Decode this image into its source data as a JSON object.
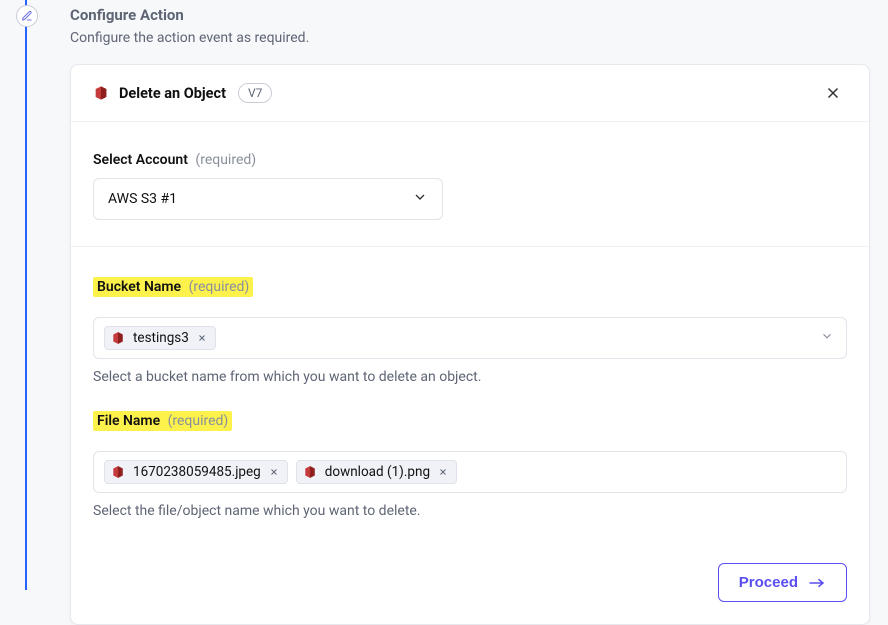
{
  "header": {
    "title": "Configure Action",
    "subtitle": "Configure the action event as required."
  },
  "card": {
    "title": "Delete an Object",
    "version": "V7"
  },
  "account": {
    "label": "Select Account",
    "required_text": "(required)",
    "value": "AWS S3 #1"
  },
  "bucket": {
    "label": "Bucket Name",
    "required_text": "(required)",
    "chips": [
      "testings3"
    ],
    "helper": "Select a bucket name from which you want to delete an object."
  },
  "file": {
    "label": "File Name",
    "required_text": "(required)",
    "chips": [
      "1670238059485.jpeg",
      "download (1).png"
    ],
    "helper": "Select the file/object name which you want to delete."
  },
  "footer": {
    "proceed": "Proceed"
  }
}
